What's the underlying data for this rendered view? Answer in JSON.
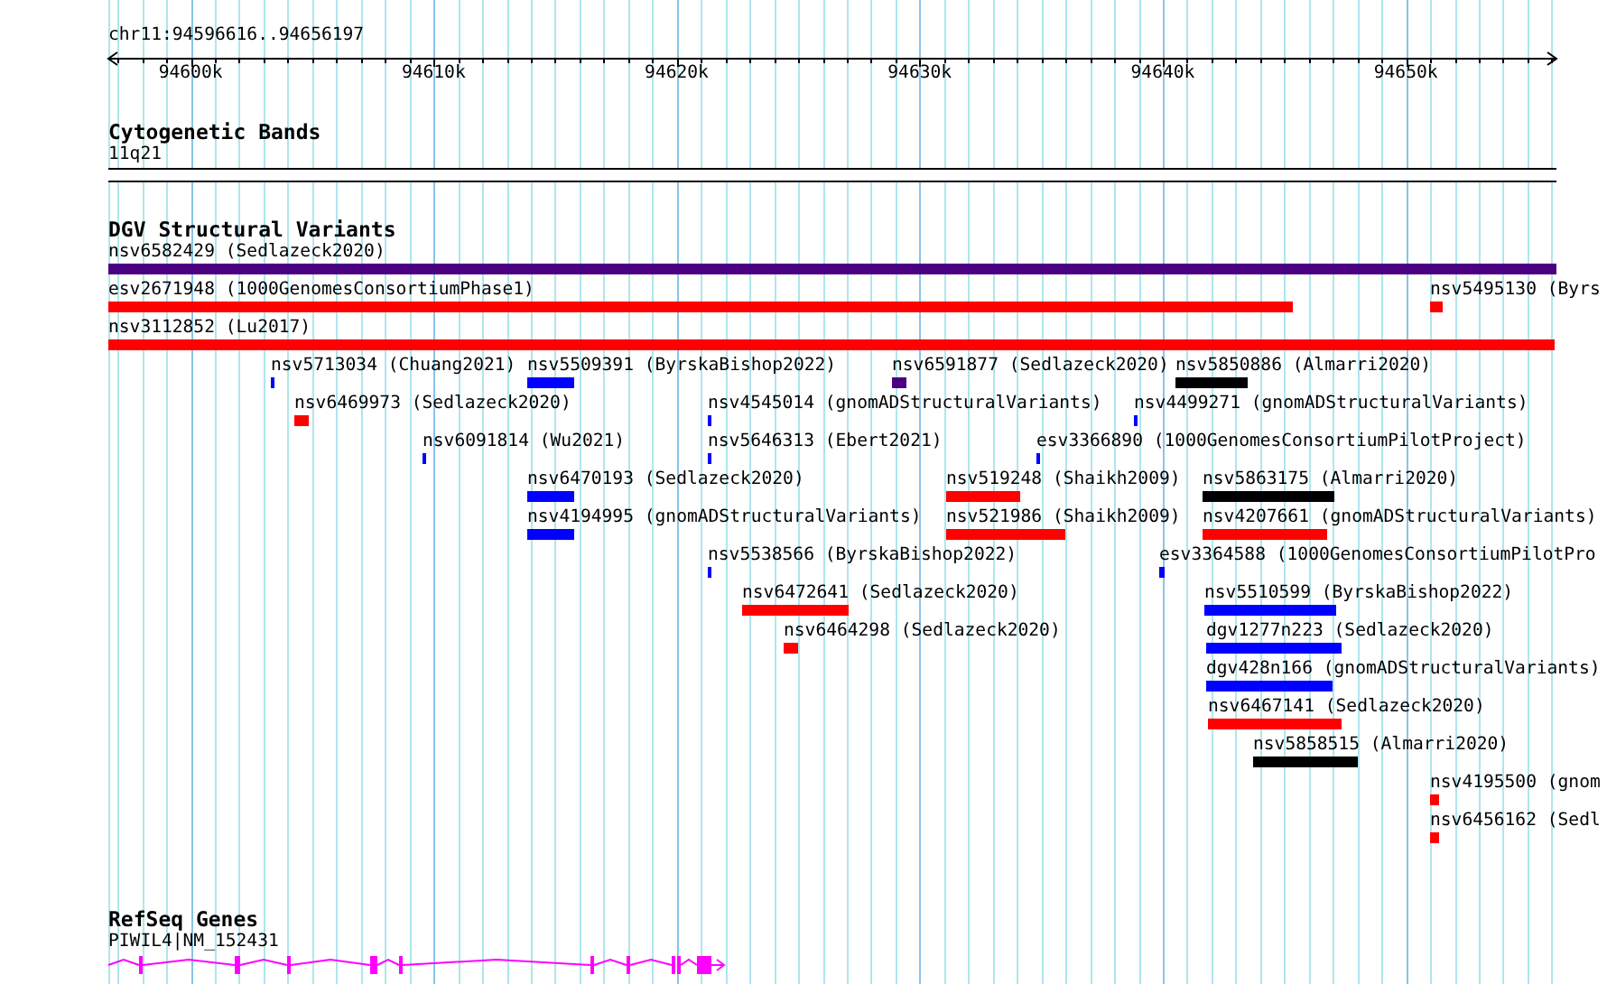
{
  "ruler": {
    "location": "chr11:94596616..94656197",
    "ticks": [
      {
        "label": "94600k"
      },
      {
        "label": "94610k"
      },
      {
        "label": "94620k"
      },
      {
        "label": "94630k"
      },
      {
        "label": "94640k"
      },
      {
        "label": "94650k"
      }
    ]
  },
  "cytogenetic_bands": {
    "title": "Cytogenetic Bands",
    "bands": [
      {
        "label": "11q21"
      }
    ]
  },
  "dgv_structural_variants": {
    "title": "DGV Structural Variants",
    "rows": [
      [
        {
          "label": "nsv6582429 (Sedlazeck2020)",
          "color": "#4b0082"
        }
      ],
      [
        {
          "label": "esv2671948 (1000GenomesConsortiumPhase1)",
          "color": "#ff0000"
        },
        {
          "label": "nsv5495130 (Byrs",
          "color": "#ff0000"
        }
      ],
      [
        {
          "label": "nsv3112852 (Lu2017)",
          "color": "#ff0000"
        }
      ],
      [
        {
          "label": "nsv5713034 (Chuang2021)",
          "color": "#0000ff"
        },
        {
          "label": "nsv5509391 (ByrskaBishop2022)",
          "color": "#0000ff"
        },
        {
          "label": "nsv6591877 (Sedlazeck2020)",
          "color": "#4b0082"
        },
        {
          "label": "nsv5850886 (Almarri2020)",
          "color": "#000000"
        }
      ],
      [
        {
          "label": "nsv6469973 (Sedlazeck2020)",
          "color": "#ff0000"
        },
        {
          "label": "nsv4545014 (gnomADStructuralVariants)",
          "color": "#0000ff"
        },
        {
          "label": "nsv4499271 (gnomADStructuralVariants)",
          "color": "#0000ff"
        }
      ],
      [
        {
          "label": "nsv6091814 (Wu2021)",
          "color": "#0000ff"
        },
        {
          "label": "nsv5646313 (Ebert2021)",
          "color": "#0000ff"
        },
        {
          "label": "esv3366890 (1000GenomesConsortiumPilotProject)",
          "color": "#0000ff"
        }
      ],
      [
        {
          "label": "nsv6470193 (Sedlazeck2020)",
          "color": "#0000ff"
        },
        {
          "label": "nsv519248 (Shaikh2009)",
          "color": "#ff0000"
        },
        {
          "label": "nsv5863175 (Almarri2020)",
          "color": "#000000"
        }
      ],
      [
        {
          "label": "nsv4194995 (gnomADStructuralVariants)",
          "color": "#0000ff"
        },
        {
          "label": "nsv521986 (Shaikh2009)",
          "color": "#ff0000"
        },
        {
          "label": "nsv4207661 (gnomADStructuralVariants)",
          "color": "#ff0000"
        }
      ],
      [
        {
          "label": "nsv5538566 (ByrskaBishop2022)",
          "color": "#0000ff"
        },
        {
          "label": "esv3364588 (1000GenomesConsortiumPilotPro",
          "color": "#0000ff"
        }
      ],
      [
        {
          "label": "nsv6472641 (Sedlazeck2020)",
          "color": "#ff0000"
        },
        {
          "label": "nsv5510599 (ByrskaBishop2022)",
          "color": "#0000ff"
        }
      ],
      [
        {
          "label": "nsv6464298 (Sedlazeck2020)",
          "color": "#ff0000"
        },
        {
          "label": "dgv1277n223 (Sedlazeck2020)",
          "color": "#0000ff"
        }
      ],
      [
        {
          "label": "dgv428n166 (gnomADStructuralVariants)",
          "color": "#0000ff"
        }
      ],
      [
        {
          "label": "nsv6467141 (Sedlazeck2020)",
          "color": "#ff0000"
        }
      ],
      [
        {
          "label": "nsv5858515 (Almarri2020)",
          "color": "#000000"
        }
      ],
      [
        {
          "label": "nsv4195500 (gnom",
          "color": "#ff0000"
        }
      ],
      [
        {
          "label": "nsv6456162 (Sedl",
          "color": "#ff0000"
        }
      ]
    ]
  },
  "refseq_genes": {
    "title": "RefSeq Genes",
    "genes": [
      {
        "label": "PIWIL4|NM_152431",
        "forward_strand": true
      }
    ]
  }
}
